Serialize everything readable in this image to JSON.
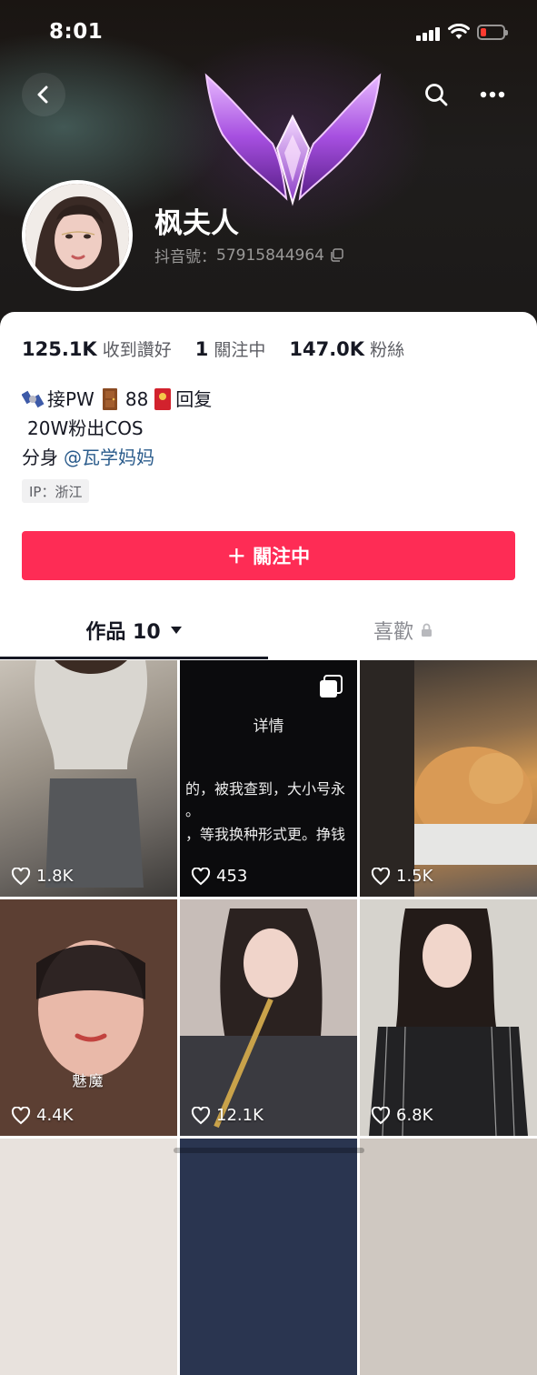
{
  "status_bar": {
    "time": "8:01"
  },
  "header": {
    "nickname": "枫夫人",
    "douyin_id_label": "抖音號：",
    "douyin_id": "57915844964"
  },
  "stats": [
    {
      "value": "125.1K",
      "label": "收到讚好"
    },
    {
      "value": "1",
      "label": "關注中"
    },
    {
      "value": "147.0K",
      "label": "粉絲"
    }
  ],
  "bio": {
    "line1_a": "接PW",
    "line1_b": "88",
    "line1_c": "回复",
    "line2": "20W粉出COS",
    "line3_prefix": "分身",
    "line3_mention": "@瓦学妈妈"
  },
  "ip_tag": "IP：浙江",
  "follow_button": {
    "label": "＋ 關注中"
  },
  "tabs": {
    "works": "作品 10",
    "likes": "喜歡"
  },
  "videos": [
    {
      "likes": "1.8K"
    },
    {
      "likes": "453",
      "title": "详情",
      "text_lines": [
        "的，被我查到，大小号永",
        "。",
        "，等我换种形式更。挣钱"
      ]
    },
    {
      "likes": "1.5K"
    },
    {
      "likes": "4.4K",
      "caption": "魅魔"
    },
    {
      "likes": "12.1K"
    },
    {
      "likes": "6.8K"
    },
    {
      "likes": ""
    },
    {
      "likes": ""
    },
    {
      "likes": ""
    }
  ],
  "colors": {
    "accent": "#fe2c55",
    "mention": "#2b5c8c"
  },
  "icons": [
    "back-icon",
    "search-icon",
    "more-icon",
    "copy-icon",
    "lock-icon",
    "heart-icon",
    "dropdown-icon",
    "multi-image-icon"
  ]
}
